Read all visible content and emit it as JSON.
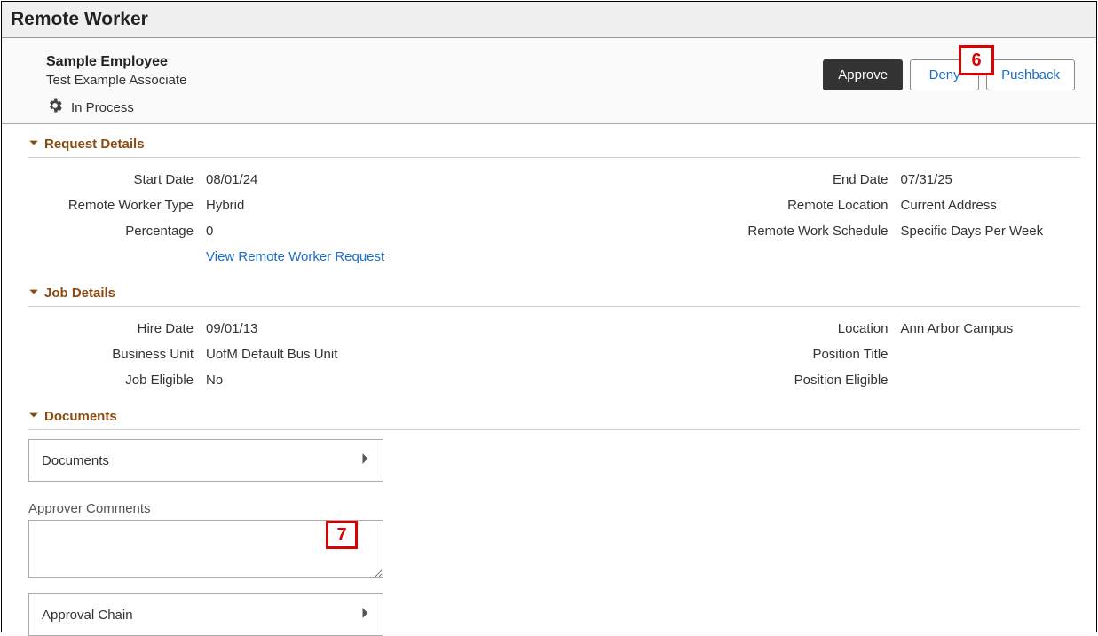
{
  "page_title": "Remote Worker",
  "employee": {
    "name": "Sample Employee",
    "title": "Test Example Associate",
    "status": "In Process"
  },
  "actions": {
    "approve": "Approve",
    "deny": "Deny",
    "pushback": "Pushback"
  },
  "sections": {
    "request_details": {
      "title": "Request Details",
      "start_date": {
        "label": "Start Date",
        "value": "08/01/24"
      },
      "end_date": {
        "label": "End Date",
        "value": "07/31/25"
      },
      "remote_worker_type": {
        "label": "Remote Worker Type",
        "value": "Hybrid"
      },
      "remote_location": {
        "label": "Remote Location",
        "value": "Current Address"
      },
      "percentage": {
        "label": "Percentage",
        "value": "0"
      },
      "remote_work_schedule": {
        "label": "Remote Work Schedule",
        "value": "Specific Days Per Week"
      },
      "view_link": "View Remote Worker Request"
    },
    "job_details": {
      "title": "Job Details",
      "hire_date": {
        "label": "Hire Date",
        "value": "09/01/13"
      },
      "location": {
        "label": "Location",
        "value": "Ann Arbor Campus"
      },
      "business_unit": {
        "label": "Business Unit",
        "value": "UofM Default Bus Unit"
      },
      "position_title": {
        "label": "Position Title",
        "value": ""
      },
      "job_eligible": {
        "label": "Job Eligible",
        "value": "No"
      },
      "position_eligible": {
        "label": "Position Eligible",
        "value": ""
      }
    },
    "documents": {
      "title": "Documents",
      "panel_label": "Documents"
    },
    "comments": {
      "label": "Approver Comments",
      "value": ""
    },
    "approval_chain": {
      "panel_label": "Approval Chain"
    }
  },
  "callouts": {
    "six": "6",
    "seven": "7"
  }
}
